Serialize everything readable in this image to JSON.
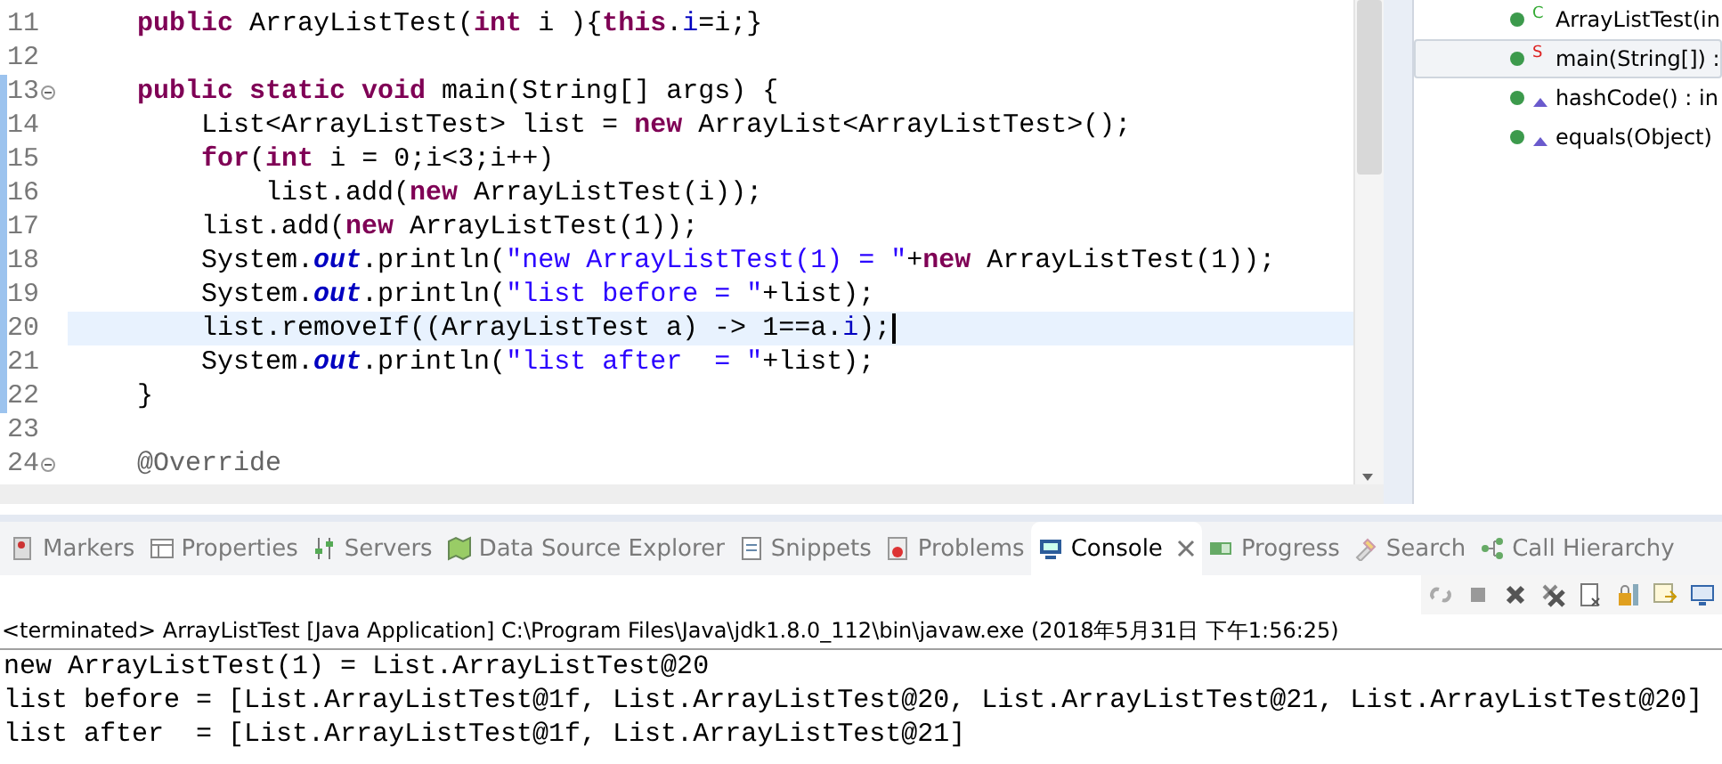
{
  "editor": {
    "lines": [
      {
        "number": "11",
        "fold": false,
        "range": false,
        "current": false,
        "tokens": [
          {
            "kind": "kw",
            "t": "    public"
          },
          {
            "kind": "plain",
            "t": " ArrayListTest("
          },
          {
            "kind": "kw",
            "t": "int"
          },
          {
            "kind": "plain",
            "t": " i ){"
          },
          {
            "kind": "kw",
            "t": "this"
          },
          {
            "kind": "plain",
            "t": "."
          },
          {
            "kind": "field",
            "t": "i"
          },
          {
            "kind": "plain",
            "t": "=i;}"
          }
        ]
      },
      {
        "number": "12",
        "fold": false,
        "range": false,
        "current": false
      },
      {
        "number": "13",
        "fold": true,
        "range": true,
        "current": false,
        "tokens": [
          {
            "kind": "kw",
            "t": "    public static void"
          },
          {
            "kind": "plain",
            "t": " main(String[] args) {"
          }
        ]
      },
      {
        "number": "14",
        "fold": false,
        "range": true,
        "current": false,
        "tokens": [
          {
            "kind": "plain",
            "t": "        List<ArrayListTest> list = "
          },
          {
            "kind": "kw",
            "t": "new"
          },
          {
            "kind": "plain",
            "t": " ArrayList<ArrayListTest>();"
          }
        ]
      },
      {
        "number": "15",
        "fold": false,
        "range": true,
        "current": false,
        "tokens": [
          {
            "kind": "kw",
            "t": "        for"
          },
          {
            "kind": "plain",
            "t": "("
          },
          {
            "kind": "kw",
            "t": "int"
          },
          {
            "kind": "plain",
            "t": " i = 0;i<3;i++)"
          }
        ]
      },
      {
        "number": "16",
        "fold": false,
        "range": true,
        "current": false,
        "tokens": [
          {
            "kind": "plain",
            "t": "            list.add("
          },
          {
            "kind": "kw",
            "t": "new"
          },
          {
            "kind": "plain",
            "t": " ArrayListTest(i));"
          }
        ]
      },
      {
        "number": "17",
        "fold": false,
        "range": true,
        "current": false,
        "tokens": [
          {
            "kind": "plain",
            "t": "        list.add("
          },
          {
            "kind": "kw",
            "t": "new"
          },
          {
            "kind": "plain",
            "t": " ArrayListTest(1));"
          }
        ]
      },
      {
        "number": "18",
        "fold": false,
        "range": true,
        "current": false,
        "tokens": [
          {
            "kind": "plain",
            "t": "        System."
          },
          {
            "kind": "static",
            "t": "out"
          },
          {
            "kind": "plain",
            "t": ".println("
          },
          {
            "kind": "str",
            "t": "\"new ArrayListTest(1) = \""
          },
          {
            "kind": "plain",
            "t": "+"
          },
          {
            "kind": "kw",
            "t": "new"
          },
          {
            "kind": "plain",
            "t": " ArrayListTest(1));"
          }
        ]
      },
      {
        "number": "19",
        "fold": false,
        "range": true,
        "current": false,
        "tokens": [
          {
            "kind": "plain",
            "t": "        System."
          },
          {
            "kind": "static",
            "t": "out"
          },
          {
            "kind": "plain",
            "t": ".println("
          },
          {
            "kind": "str",
            "t": "\"list before = \""
          },
          {
            "kind": "plain",
            "t": "+list);"
          }
        ]
      },
      {
        "number": "20",
        "fold": false,
        "range": true,
        "current": true,
        "tokens": [
          {
            "kind": "plain",
            "t": "        list.removeIf((ArrayListTest a) -> 1==a."
          },
          {
            "kind": "field",
            "t": "i"
          },
          {
            "kind": "plain",
            "t": ");"
          }
        ]
      },
      {
        "number": "21",
        "fold": false,
        "range": true,
        "current": false,
        "tokens": [
          {
            "kind": "plain",
            "t": "        System."
          },
          {
            "kind": "static",
            "t": "out"
          },
          {
            "kind": "plain",
            "t": ".println("
          },
          {
            "kind": "str",
            "t": "\"list after  = \""
          },
          {
            "kind": "plain",
            "t": "+list);"
          }
        ]
      },
      {
        "number": "22",
        "fold": false,
        "range": true,
        "current": false,
        "tokens": [
          {
            "kind": "plain",
            "t": "    }"
          }
        ]
      },
      {
        "number": "23",
        "fold": false,
        "range": false,
        "current": false
      },
      {
        "number": "24",
        "fold": true,
        "range": false,
        "current": false,
        "tokens": [
          {
            "kind": "ann",
            "t": "    @Override"
          }
        ]
      }
    ]
  },
  "outline": {
    "items": [
      {
        "label": "ArrayListTest(in",
        "kind": "constructor",
        "badge": "C",
        "selected": false
      },
      {
        "label": "main(String[]) :",
        "kind": "static",
        "badge": "S",
        "selected": true
      },
      {
        "label": "hashCode() : in",
        "kind": "override",
        "selected": false
      },
      {
        "label": "equals(Object)",
        "kind": "override",
        "selected": false
      }
    ]
  },
  "tabs": [
    {
      "label": "Markers",
      "selected": false
    },
    {
      "label": "Properties",
      "selected": false
    },
    {
      "label": "Servers",
      "selected": false
    },
    {
      "label": "Data Source Explorer",
      "selected": false
    },
    {
      "label": "Snippets",
      "selected": false
    },
    {
      "label": "Problems",
      "selected": false
    },
    {
      "label": "Console",
      "selected": true
    },
    {
      "label": "Progress",
      "selected": false
    },
    {
      "label": "Search",
      "selected": false
    },
    {
      "label": "Call Hierarchy",
      "selected": false
    }
  ],
  "console": {
    "header": "<terminated> ArrayListTest [Java Application] C:\\Program Files\\Java\\jdk1.8.0_112\\bin\\javaw.exe (2018年5月31日 下午1:56:25)",
    "output": [
      "new ArrayListTest(1) = List.ArrayListTest@20",
      "list before = [List.ArrayListTest@1f, List.ArrayListTest@20, List.ArrayListTest@21, List.ArrayListTest@20]",
      "list after  = [List.ArrayListTest@1f, List.ArrayListTest@21]"
    ]
  }
}
